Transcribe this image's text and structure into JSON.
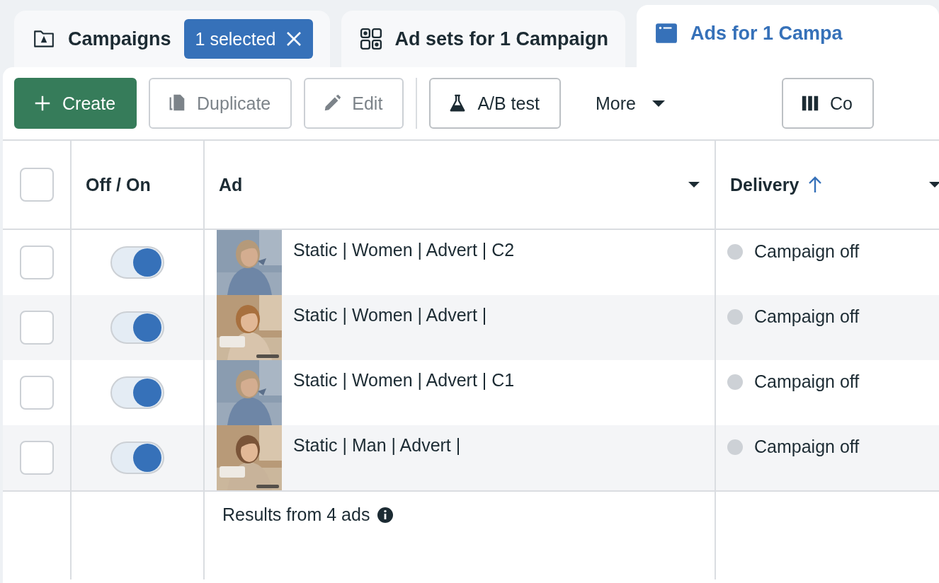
{
  "tabs": [
    {
      "label": "Campaigns",
      "selected": false,
      "chip": "1 selected"
    },
    {
      "label": "Ad sets for 1 Campaign",
      "selected": false
    },
    {
      "label": "Ads for 1 Campa",
      "selected": true
    }
  ],
  "toolbar": [
    {
      "kind": "primary",
      "label": "Create",
      "disabled": false
    },
    {
      "kind": "outline",
      "label": "Duplicate",
      "disabled": true
    },
    {
      "kind": "outline",
      "label": "Edit",
      "disabled": true
    },
    {
      "kind": "divider"
    },
    {
      "kind": "outline",
      "label": "A/B test",
      "disabled": false
    },
    {
      "kind": "plain",
      "label": "More",
      "disabled": false
    },
    {
      "kind": "spacer"
    },
    {
      "kind": "outline",
      "label": "Co",
      "disabled": false
    }
  ],
  "table": {
    "select_all": {
      "checked": false
    },
    "columns": [
      {
        "label": "Off / On",
        "menu": false,
        "sorted": false
      },
      {
        "label": "Ad",
        "menu": true,
        "sorted": false
      },
      {
        "label": "Delivery",
        "menu": true,
        "sorted": true
      }
    ],
    "rows": [
      {
        "checked": false,
        "on": true,
        "name": "Static | Women | Advert | C2",
        "delivery": "Campaign off",
        "color": "#cdd1d6"
      },
      {
        "checked": false,
        "on": true,
        "name": "Static | Women | Advert |",
        "delivery": "Campaign off",
        "color": "#cdd1d6"
      },
      {
        "checked": false,
        "on": true,
        "name": "Static | Women | Advert | C1",
        "delivery": "Campaign off",
        "color": "#cdd1d6"
      },
      {
        "checked": false,
        "on": true,
        "name": "Static | Man | Advert |",
        "delivery": "Campaign off",
        "color": "#cdd1d6"
      }
    ],
    "footer": "Results from 4 ads"
  }
}
